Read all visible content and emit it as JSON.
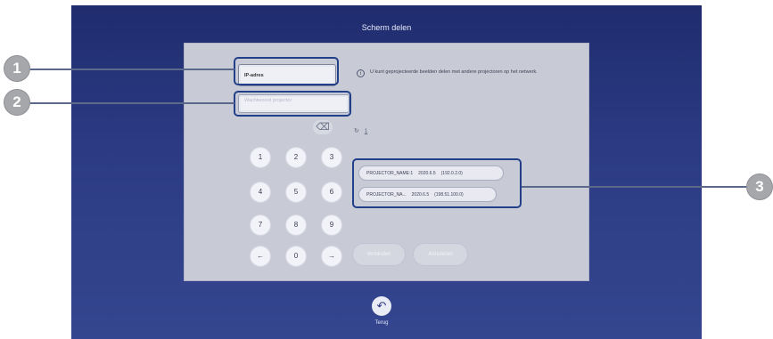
{
  "screen": {
    "title": "Scherm delen"
  },
  "ip_field": {
    "value": "IP-adres"
  },
  "password_field": {
    "placeholder": "Wachtwoord projector"
  },
  "info_text": "U kunt geprojecteerde beelden delen met andere projectoren op het netwerk.",
  "keypad": {
    "keys": [
      "1",
      "2",
      "3",
      "4",
      "5",
      "6",
      "7",
      "8",
      "9",
      "←",
      "0",
      "→"
    ],
    "backspace": "⌫"
  },
  "history": {
    "icon": "history-icon",
    "count": "1"
  },
  "projectors": [
    {
      "name": "PROJECTOR_NAME:1",
      "date": "2020.6.5",
      "ip": "(192.0.2.0)"
    },
    {
      "name": "PROJECTOR_NA...",
      "date": "2020.6.5",
      "ip": "(198.51.100.0)"
    }
  ],
  "buttons": {
    "connect": "Verbinden",
    "cancel": "Annuleren"
  },
  "back": {
    "label": "Terug",
    "icon": "back-arrow-icon"
  },
  "callouts": [
    "1",
    "2",
    "3"
  ]
}
